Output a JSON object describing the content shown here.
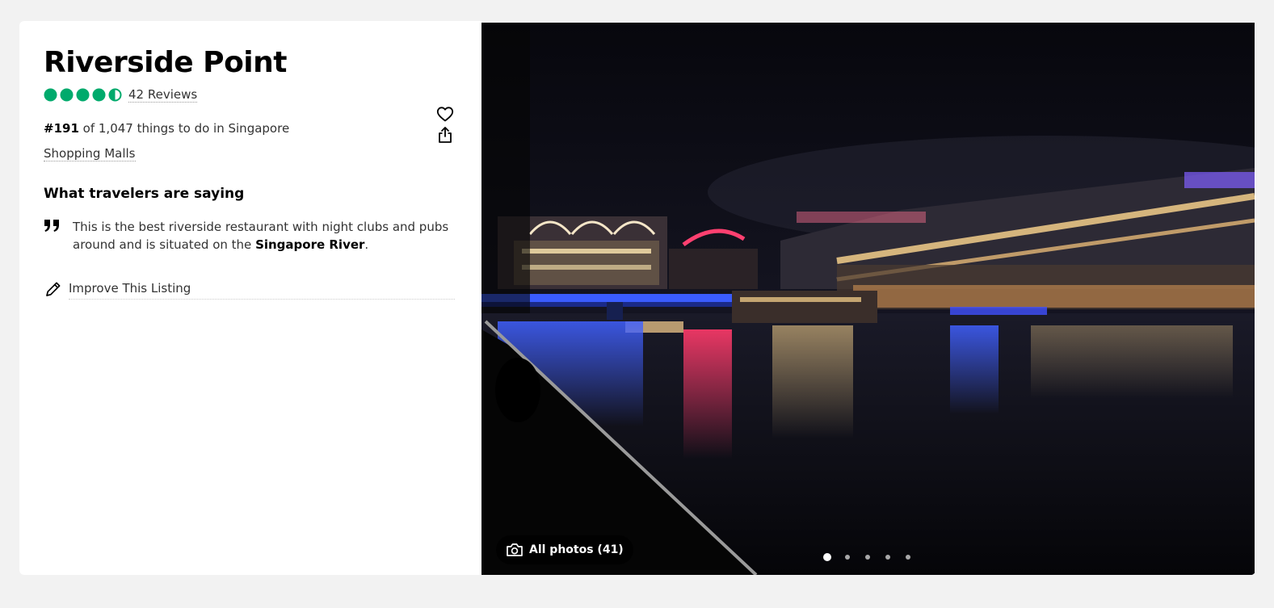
{
  "listing": {
    "title": "Riverside Point",
    "rating_bubbles": 4.5,
    "reviews_label": "42 Reviews",
    "rank_number": "#191",
    "rank_text": " of 1,047 things to do in Singapore",
    "category": "Shopping Malls"
  },
  "actions": {
    "heart_icon": "heart-icon",
    "share_icon": "share-icon"
  },
  "travelers": {
    "heading": "What travelers are saying",
    "quote_text": "This is the best riverside restaurant with night clubs and pubs around and is situated on the ",
    "quote_bold": "Singapore River",
    "quote_end": "."
  },
  "improve": {
    "label": "Improve This Listing"
  },
  "gallery": {
    "all_photos_label": "All photos (41)",
    "dot_count": 5,
    "active_dot": 1
  },
  "colors": {
    "accent_green": "#00aa6c",
    "background": "#f2f2f2"
  }
}
